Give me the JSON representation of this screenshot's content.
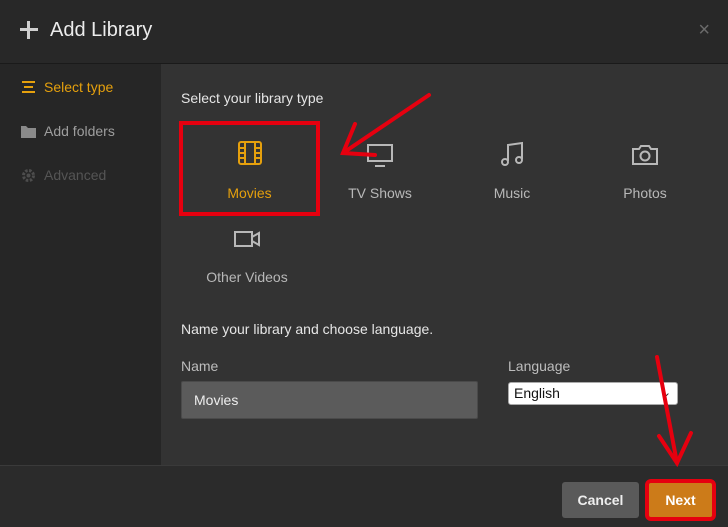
{
  "dialog": {
    "title": "Add Library",
    "close_label": "×"
  },
  "sidebar": {
    "items": [
      {
        "label": "Select type",
        "state": "active",
        "icon": "list-icon"
      },
      {
        "label": "Add folders",
        "state": "normal",
        "icon": "folder-icon"
      },
      {
        "label": "Advanced",
        "state": "disabled",
        "icon": "gear-icon"
      }
    ]
  },
  "main": {
    "type_heading": "Select your library type",
    "types": [
      {
        "label": "Movies",
        "icon": "film-icon",
        "selected": true
      },
      {
        "label": "TV Shows",
        "icon": "tv-icon",
        "selected": false
      },
      {
        "label": "Music",
        "icon": "music-icon",
        "selected": false
      },
      {
        "label": "Photos",
        "icon": "camera-icon",
        "selected": false
      },
      {
        "label": "Other Videos",
        "icon": "video-camera-icon",
        "selected": false
      }
    ],
    "name_heading": "Name your library and choose language.",
    "name_label": "Name",
    "name_value": "Movies",
    "language_label": "Language",
    "language_value": "English"
  },
  "footer": {
    "cancel_label": "Cancel",
    "next_label": "Next"
  },
  "colors": {
    "accent": "#e5a00d",
    "next_button": "#cc7b19",
    "annotation": "#e6000f"
  }
}
